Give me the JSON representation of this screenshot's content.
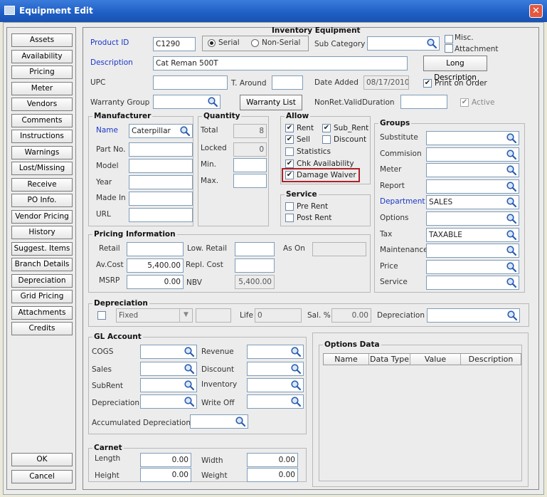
{
  "window": {
    "title": "Equipment Edit",
    "close": "✕"
  },
  "nav": [
    "Assets",
    "Availability",
    "Pricing",
    "Meter",
    "Vendors",
    "Comments",
    "Instructions",
    "Warnings",
    "Lost/Missing",
    "Receive",
    "PO Info.",
    "Vendor Pricing",
    "History",
    "Suggest. Items",
    "Branch Details",
    "Depreciation",
    "Grid Pricing",
    "Attachments",
    "Credits"
  ],
  "footer": {
    "ok": "OK",
    "cancel": "Cancel"
  },
  "inventory": {
    "title": "Inventory Equipment",
    "product_id_label": "Product ID",
    "product_id": "C1290",
    "serial": "Serial",
    "nonserial": "Non-Serial",
    "subcat_label": "Sub Category",
    "subcat": "",
    "misc": "Misc.",
    "attachment": "Attachment",
    "desc_label": "Description",
    "desc": "Cat Reman 500T",
    "long_desc": "Long Description",
    "upc_label": "UPC",
    "upc": "",
    "taround_label": "T. Around",
    "taround": "",
    "date_added_label": "Date Added",
    "date_added": "08/17/2010",
    "print_on_order": "Print on Order",
    "warranty_group_label": "Warranty Group",
    "warranty_group": "",
    "warranty_list": "Warranty List",
    "nonret_label": "NonRet.ValidDuration",
    "nonret": "",
    "active": "Active"
  },
  "manufacturer": {
    "title": "Manufacturer",
    "name_label": "Name",
    "name": "Caterpillar",
    "partno_label": "Part No.",
    "partno": "",
    "model_label": "Model",
    "model": "",
    "year_label": "Year",
    "year": "",
    "madein_label": "Made In",
    "madein": "",
    "url_label": "URL",
    "url": ""
  },
  "quantity": {
    "title": "Quantity",
    "total_label": "Total",
    "total": "8",
    "locked_label": "Locked",
    "locked": "0",
    "min_label": "Min.",
    "min": "",
    "max_label": "Max.",
    "max": ""
  },
  "allow": {
    "title": "Allow",
    "rent": "Rent",
    "subrent": "Sub_Rent",
    "sell": "Sell",
    "discount": "Discount",
    "statistics": "Statistics",
    "chk": "Chk Availability",
    "damage": "Damage Waiver"
  },
  "service": {
    "title": "Service",
    "pre": "Pre Rent",
    "post": "Post Rent"
  },
  "groups": {
    "title": "Groups",
    "rows": [
      {
        "label": "Substitute",
        "value": ""
      },
      {
        "label": "Commision",
        "value": ""
      },
      {
        "label": "Meter",
        "value": ""
      },
      {
        "label": "Report",
        "value": ""
      },
      {
        "label": "Department",
        "value": "SALES"
      },
      {
        "label": "Options",
        "value": ""
      },
      {
        "label": "Tax",
        "value": "TAXABLE"
      },
      {
        "label": "Maintenance",
        "value": ""
      },
      {
        "label": "Price",
        "value": ""
      },
      {
        "label": "Service",
        "value": ""
      }
    ]
  },
  "pricing": {
    "title": "Pricing Information",
    "retail_label": "Retail",
    "retail": "",
    "lowretail_label": "Low. Retail",
    "lowretail": "",
    "ason_label": "As On",
    "ason": "",
    "avcost_label": "Av.Cost",
    "avcost": "5,400.00",
    "replcost_label": "Repl. Cost",
    "replcost": "",
    "msrp_label": "MSRP",
    "msrp": "0.00",
    "nbv_label": "NBV",
    "nbv": "5,400.00"
  },
  "depreciation": {
    "title": "Depreciation",
    "method": "Fixed",
    "life_label": "Life",
    "life": "0",
    "sal_label": "Sal. %",
    "sal": "0.00",
    "dep_label": "Depreciation",
    "dep": ""
  },
  "gl": {
    "title": "GL Account",
    "cogs": "COGS",
    "revenue": "Revenue",
    "sales": "Sales",
    "discount": "Discount",
    "subrent": "SubRent",
    "inventory": "Inventory",
    "depreciation": "Depreciation",
    "writeoff": "Write Off",
    "accum": "Accumulated Depreciation"
  },
  "options": {
    "title": "Options Data",
    "cols": [
      "Name",
      "Data Type",
      "Value",
      "Description"
    ]
  },
  "carnet": {
    "title": "Carnet",
    "length_label": "Length",
    "length": "0.00",
    "width_label": "Width",
    "width": "0.00",
    "height_label": "Height",
    "height": "0.00",
    "weight_label": "Weight",
    "weight": "0.00"
  }
}
